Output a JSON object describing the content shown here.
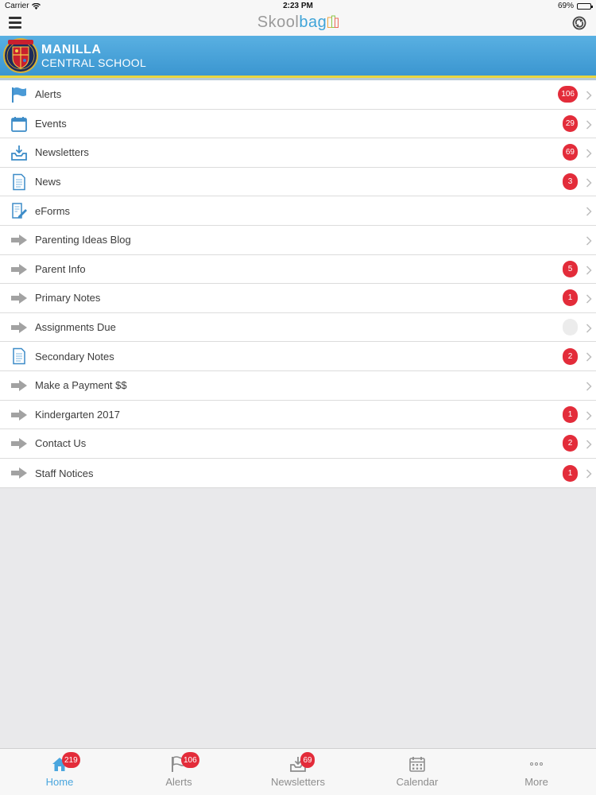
{
  "status_bar": {
    "carrier": "Carrier",
    "time": "2:23 PM",
    "battery": "69%",
    "battery_level": 0.69
  },
  "nav_bar": {
    "logo_part1": "Skool",
    "logo_part2": "bag"
  },
  "banner": {
    "school_line1": "MANILLA",
    "school_line2": "CENTRAL SCHOOL",
    "crest_text": "MANILLA"
  },
  "menu": {
    "items": [
      {
        "label": "Alerts",
        "badge": "106",
        "icon": "flag-icon"
      },
      {
        "label": "Events",
        "badge": "29",
        "icon": "calendar-icon"
      },
      {
        "label": "Newsletters",
        "badge": "69",
        "icon": "inbox-download-icon"
      },
      {
        "label": "News",
        "badge": "3",
        "icon": "document-icon"
      },
      {
        "label": "eForms",
        "badge": "",
        "icon": "form-edit-icon"
      },
      {
        "label": "Parenting Ideas Blog",
        "badge": "",
        "icon": "arrow-right-icon"
      },
      {
        "label": "Parent Info",
        "badge": "5",
        "icon": "arrow-right-icon"
      },
      {
        "label": "Primary Notes",
        "badge": "1",
        "icon": "arrow-right-icon"
      },
      {
        "label": "Assignments Due",
        "badge": "",
        "icon": "arrow-right-icon"
      },
      {
        "label": "Secondary Notes",
        "badge": "2",
        "icon": "document-icon"
      },
      {
        "label": "Make a Payment $$",
        "badge": "",
        "icon": "arrow-right-icon"
      },
      {
        "label": "Kindergarten 2017",
        "badge": "1",
        "icon": "arrow-right-icon"
      },
      {
        "label": "Contact Us",
        "badge": "2",
        "icon": "arrow-right-icon"
      },
      {
        "label": "Staff Notices",
        "badge": "1",
        "icon": "arrow-right-icon"
      }
    ]
  },
  "tab_bar": {
    "tabs": [
      {
        "label": "Home",
        "badge": "219",
        "icon": "home-icon"
      },
      {
        "label": "Alerts",
        "badge": "106",
        "icon": "flag-icon"
      },
      {
        "label": "Newsletters",
        "badge": "69",
        "icon": "inbox-download-icon"
      },
      {
        "label": "Calendar",
        "badge": "",
        "icon": "calendar-icon"
      },
      {
        "label": "More",
        "badge": "",
        "icon": "more-dots-icon"
      }
    ]
  },
  "colors": {
    "accent": "#4aa6de",
    "badge": "#e32c3a",
    "banner_top": "#59b0e2",
    "banner_bottom": "#3b96d0",
    "banner_stripe": "#e8d640"
  }
}
